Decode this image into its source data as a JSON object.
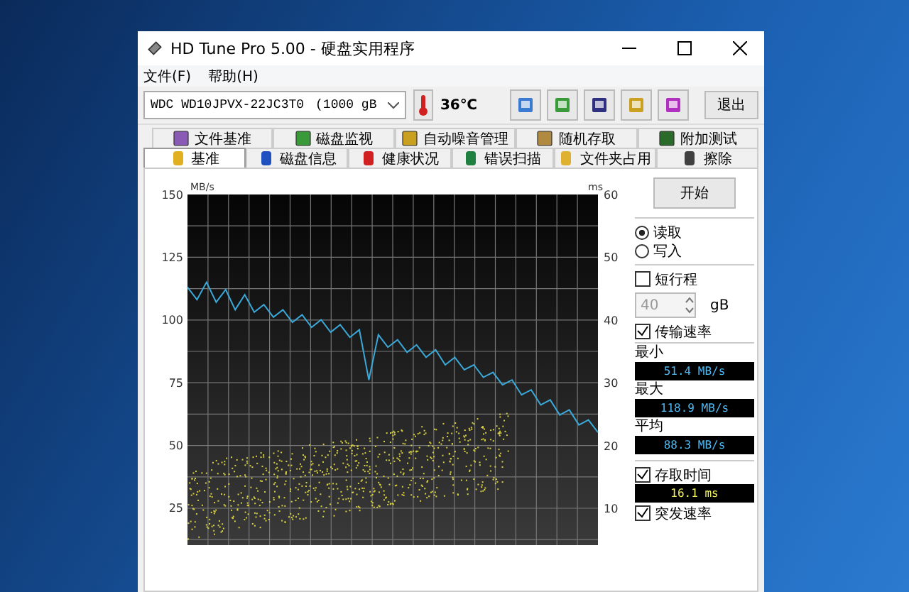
{
  "window": {
    "title": "HD Tune Pro 5.00 - 硬盘实用程序"
  },
  "menu": [
    "文件(F)",
    "帮助(H)"
  ],
  "toolbar": {
    "drive": "WDC WD10JPVX-22JC3T0",
    "capacity": "(1000 gB",
    "temperature": "36℃",
    "exit": "退出"
  },
  "tabs_top": [
    {
      "label": "文件基准",
      "selected": false
    },
    {
      "label": "磁盘监视",
      "selected": false
    },
    {
      "label": "自动噪音管理",
      "selected": false
    },
    {
      "label": "随机存取",
      "selected": false
    },
    {
      "label": "附加测试",
      "selected": false
    }
  ],
  "tabs_bottom": [
    {
      "label": "基准",
      "selected": true
    },
    {
      "label": "磁盘信息",
      "selected": false
    },
    {
      "label": "健康状况",
      "selected": false
    },
    {
      "label": "错误扫描",
      "selected": false
    },
    {
      "label": "文件夹占用",
      "selected": false
    },
    {
      "label": "擦除",
      "selected": false
    }
  ],
  "chart": {
    "right_unit": "ms",
    "right_ticks": [
      "60",
      "50",
      "40",
      "30",
      "20",
      "10"
    ],
    "chart_data": {
      "type": "line",
      "grid": true,
      "ylabel": "MB/s",
      "ylim": [
        10,
        150
      ],
      "yticks": [
        150,
        125,
        100,
        75,
        50,
        25
      ],
      "series": [
        {
          "color": "#3aa8d8",
          "values": [
            113,
            108,
            115,
            107,
            112,
            104,
            110,
            103,
            106,
            101,
            104,
            99,
            102,
            97,
            100,
            95,
            98,
            93,
            96,
            76,
            94,
            89,
            92,
            87,
            90,
            85,
            88,
            82,
            85,
            80,
            82,
            77,
            79,
            74,
            76,
            70,
            72,
            66,
            68,
            62,
            64,
            58,
            60,
            55
          ]
        }
      ]
    }
  },
  "panel": {
    "start": "开始",
    "modes": [
      {
        "label": "读取",
        "selected": true
      },
      {
        "label": "写入",
        "selected": false
      }
    ],
    "short_stroke": {
      "label": "短行程",
      "checked": false,
      "value": "40",
      "unit": "gB"
    },
    "transfer": {
      "label": "传输速率",
      "checked": true
    },
    "stats": [
      {
        "label": "最小",
        "value": "51.4 MB/s"
      },
      {
        "label": "最大",
        "value": "118.9 MB/s"
      },
      {
        "label": "平均",
        "value": "88.3 MB/s"
      }
    ],
    "access": {
      "label": "存取时间",
      "checked": true,
      "value": "16.1 ms"
    },
    "burst": {
      "label": "突发速率",
      "checked": true
    }
  }
}
